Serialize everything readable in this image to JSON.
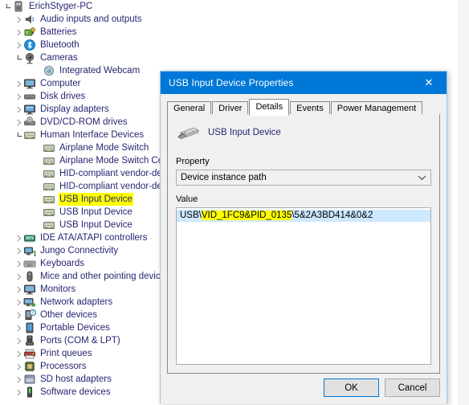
{
  "tree": {
    "root_label": "ErichStyger-PC",
    "items": [
      {
        "label": "ErichStyger-PC",
        "icon": "computer-pc-icon",
        "indent": 0,
        "twisty": "open",
        "highlight": false
      },
      {
        "label": "Audio inputs and outputs",
        "icon": "speaker-icon",
        "indent": 1,
        "twisty": "closed",
        "highlight": false
      },
      {
        "label": "Batteries",
        "icon": "battery-icon",
        "indent": 1,
        "twisty": "closed",
        "highlight": false
      },
      {
        "label": "Bluetooth",
        "icon": "bluetooth-icon",
        "indent": 1,
        "twisty": "closed",
        "highlight": false
      },
      {
        "label": "Cameras",
        "icon": "camera-icon",
        "indent": 1,
        "twisty": "open",
        "highlight": false
      },
      {
        "label": "Integrated Webcam",
        "icon": "webcam-icon",
        "indent": 2,
        "twisty": "none",
        "highlight": false
      },
      {
        "label": "Computer",
        "icon": "monitor-icon",
        "indent": 1,
        "twisty": "closed",
        "highlight": false
      },
      {
        "label": "Disk drives",
        "icon": "disk-drive-icon",
        "indent": 1,
        "twisty": "closed",
        "highlight": false
      },
      {
        "label": "Display adapters",
        "icon": "display-adapter-icon",
        "indent": 1,
        "twisty": "closed",
        "highlight": false
      },
      {
        "label": "DVD/CD-ROM drives",
        "icon": "dvd-drive-icon",
        "indent": 1,
        "twisty": "closed",
        "highlight": false
      },
      {
        "label": "Human Interface Devices",
        "icon": "hid-icon",
        "indent": 1,
        "twisty": "open",
        "highlight": false
      },
      {
        "label": "Airplane Mode Switch",
        "icon": "hid-icon",
        "indent": 2,
        "twisty": "none",
        "highlight": false
      },
      {
        "label": "Airplane Mode Switch Col",
        "icon": "hid-icon",
        "indent": 2,
        "twisty": "none",
        "highlight": false
      },
      {
        "label": "HID-compliant vendor-de",
        "icon": "hid-icon",
        "indent": 2,
        "twisty": "none",
        "highlight": false
      },
      {
        "label": "HID-compliant vendor-de",
        "icon": "hid-icon",
        "indent": 2,
        "twisty": "none",
        "highlight": false
      },
      {
        "label": "USB Input Device",
        "icon": "hid-icon",
        "indent": 2,
        "twisty": "none",
        "highlight": true
      },
      {
        "label": "USB Input Device",
        "icon": "hid-icon",
        "indent": 2,
        "twisty": "none",
        "highlight": false
      },
      {
        "label": "USB Input Device",
        "icon": "hid-icon",
        "indent": 2,
        "twisty": "none",
        "highlight": false
      },
      {
        "label": "IDE ATA/ATAPI controllers",
        "icon": "ide-controller-icon",
        "indent": 1,
        "twisty": "closed",
        "highlight": false
      },
      {
        "label": "Jungo Connectivity",
        "icon": "jungo-icon",
        "indent": 1,
        "twisty": "closed",
        "highlight": false
      },
      {
        "label": "Keyboards",
        "icon": "keyboard-icon",
        "indent": 1,
        "twisty": "closed",
        "highlight": false
      },
      {
        "label": "Mice and other pointing devic",
        "icon": "mouse-icon",
        "indent": 1,
        "twisty": "closed",
        "highlight": false
      },
      {
        "label": "Monitors",
        "icon": "monitor-icon",
        "indent": 1,
        "twisty": "closed",
        "highlight": false
      },
      {
        "label": "Network adapters",
        "icon": "network-adapter-icon",
        "indent": 1,
        "twisty": "closed",
        "highlight": false
      },
      {
        "label": "Other devices",
        "icon": "other-device-icon",
        "indent": 1,
        "twisty": "closed",
        "highlight": false
      },
      {
        "label": "Portable Devices",
        "icon": "portable-device-icon",
        "indent": 1,
        "twisty": "closed",
        "highlight": false
      },
      {
        "label": "Ports (COM & LPT)",
        "icon": "port-icon",
        "indent": 1,
        "twisty": "closed",
        "highlight": false
      },
      {
        "label": "Print queues",
        "icon": "printer-icon",
        "indent": 1,
        "twisty": "closed",
        "highlight": false
      },
      {
        "label": "Processors",
        "icon": "processor-icon",
        "indent": 1,
        "twisty": "closed",
        "highlight": false
      },
      {
        "label": "SD host adapters",
        "icon": "sd-host-icon",
        "indent": 1,
        "twisty": "closed",
        "highlight": false
      },
      {
        "label": "Software devices",
        "icon": "software-device-icon",
        "indent": 1,
        "twisty": "closed",
        "highlight": false
      }
    ]
  },
  "dialog": {
    "title": "USB Input Device Properties",
    "close_label": "✕",
    "tabs": [
      {
        "label": "General",
        "active": false
      },
      {
        "label": "Driver",
        "active": false
      },
      {
        "label": "Details",
        "active": true
      },
      {
        "label": "Events",
        "active": false
      },
      {
        "label": "Power Management",
        "active": false
      }
    ],
    "device_name": "USB Input Device",
    "property_label": "Property",
    "property_value": "Device instance path",
    "value_label": "Value",
    "value_prefix": "USB\\",
    "value_highlight": "VID_1FC9&PID_0135",
    "value_suffix": "\\5&2A3BD414&0&2",
    "ok_label": "OK",
    "cancel_label": "Cancel"
  },
  "colors": {
    "titlebar": "#0078d7",
    "highlight": "#ffff00",
    "selection": "#cde8ff",
    "tree_text": "#262673",
    "dialog_bg": "#f0f0f0",
    "focus_border": "#0078d7"
  }
}
